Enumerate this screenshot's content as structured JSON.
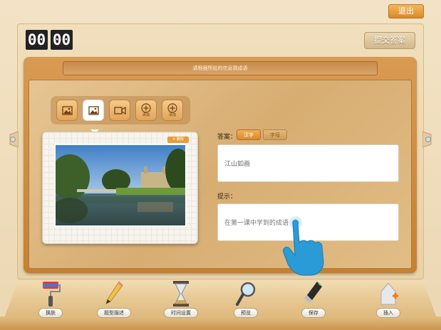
{
  "header": {
    "exit_label": "退出",
    "submit_label": "提交答案"
  },
  "timer": {
    "digits": [
      "00",
      "00"
    ]
  },
  "question": {
    "prompt": "请根据所给的信息猜成语"
  },
  "media_toolbar": {
    "items": [
      {
        "icon": "image-icon",
        "label": ""
      },
      {
        "icon": "image-icon",
        "label": "",
        "active": true
      },
      {
        "icon": "video-icon",
        "label": ""
      },
      {
        "icon": "plus-circle-icon",
        "label": "添加"
      },
      {
        "icon": "plus-circle-icon",
        "label": "添加"
      }
    ]
  },
  "photo": {
    "delete_label": "删除"
  },
  "answer": {
    "label": "答案：",
    "tabs": [
      {
        "label": "汉字",
        "active": true
      },
      {
        "label": "字母",
        "active": false
      }
    ],
    "value": "江山如画"
  },
  "hint": {
    "label": "提示：",
    "value": "在第一课中学到的成语"
  },
  "bottom_toolbar": {
    "items": [
      {
        "label": "换肤",
        "icon": "paint-roller-icon"
      },
      {
        "label": "题型描述",
        "icon": "pencil-icon"
      },
      {
        "label": "时间设置",
        "icon": "hourglass-icon"
      },
      {
        "label": "预览",
        "icon": "magnifier-icon"
      },
      {
        "label": "保存",
        "icon": "usb-drive-icon"
      },
      {
        "label": "插入",
        "icon": "insert-icon"
      }
    ]
  },
  "colors": {
    "accent": "#e0993e",
    "frame": "#c7802f",
    "dark_digit": "#222222",
    "touch_hand": "#2b9fd8"
  }
}
